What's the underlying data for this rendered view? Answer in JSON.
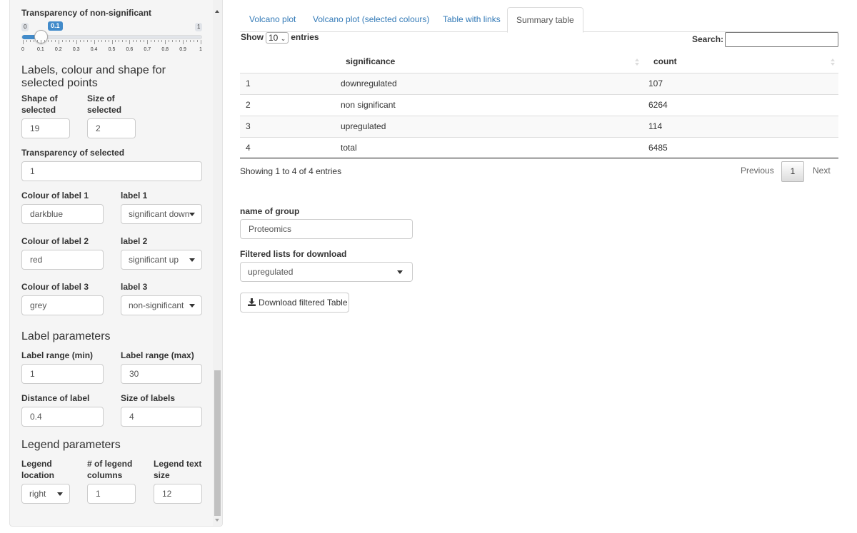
{
  "sidebar": {
    "transparency_ns_label": "Transparency of non-significant",
    "slider": {
      "min_label": "0",
      "max_label": "1",
      "value_label": "0.1",
      "value": 0.1,
      "ticks": [
        "0",
        "0.1",
        "0.2",
        "0.3",
        "0.4",
        "0.5",
        "0.6",
        "0.7",
        "0.8",
        "0.9",
        "1"
      ]
    },
    "selected_heading": "Labels, colour and shape for selected points",
    "shape_label": "Shape of selected",
    "shape_value": "19",
    "size_label": "Size of selected",
    "size_value": "2",
    "transparency_sel_label": "Transparency of selected",
    "transparency_sel_value": "1",
    "colour1_label": "Colour of label 1",
    "colour1_value": "darkblue",
    "label1_label": "label 1",
    "label1_value": "significant down",
    "colour2_label": "Colour of label 2",
    "colour2_value": "red",
    "label2_label": "label 2",
    "label2_value": "significant up",
    "colour3_label": "Colour of label 3",
    "colour3_value": "grey",
    "label3_label": "label 3",
    "label3_value": "non-significant",
    "label_params_heading": "Label parameters",
    "range_min_label": "Label range (min)",
    "range_min_value": "1",
    "range_max_label": "Label range (max)",
    "range_max_value": "30",
    "distance_label": "Distance of label",
    "distance_value": "0.4",
    "size_labels_label": "Size of labels",
    "size_labels_value": "4",
    "legend_heading": "Legend parameters",
    "legend_loc_label": "Legend location",
    "legend_loc_value": "right",
    "legend_cols_label": "# of legend columns",
    "legend_cols_value": "1",
    "legend_text_label": "Legend text size",
    "legend_text_value": "12"
  },
  "tabs": [
    "Volcano plot",
    "Volcano plot (selected colours)",
    "Table with links",
    "Summary table"
  ],
  "table": {
    "show_label": "Show",
    "entries_value": "10",
    "entries_label": "entries",
    "search_label": "Search:",
    "columns": [
      "significance",
      "count"
    ],
    "rows": [
      {
        "idx": "1",
        "significance": "downregulated",
        "count": "107"
      },
      {
        "idx": "2",
        "significance": "non significant",
        "count": "6264"
      },
      {
        "idx": "3",
        "significance": "upregulated",
        "count": "114"
      },
      {
        "idx": "4",
        "significance": "total",
        "count": "6485"
      }
    ],
    "info": "Showing 1 to 4 of 4 entries",
    "previous": "Previous",
    "page": "1",
    "next": "Next"
  },
  "group": {
    "name_label": "name of group",
    "name_value": "Proteomics",
    "filter_label": "Filtered lists for download",
    "filter_value": "upregulated",
    "download_label": "Download filtered Table"
  },
  "colors": {
    "link": "#337ab7",
    "slider": "#428bca"
  }
}
